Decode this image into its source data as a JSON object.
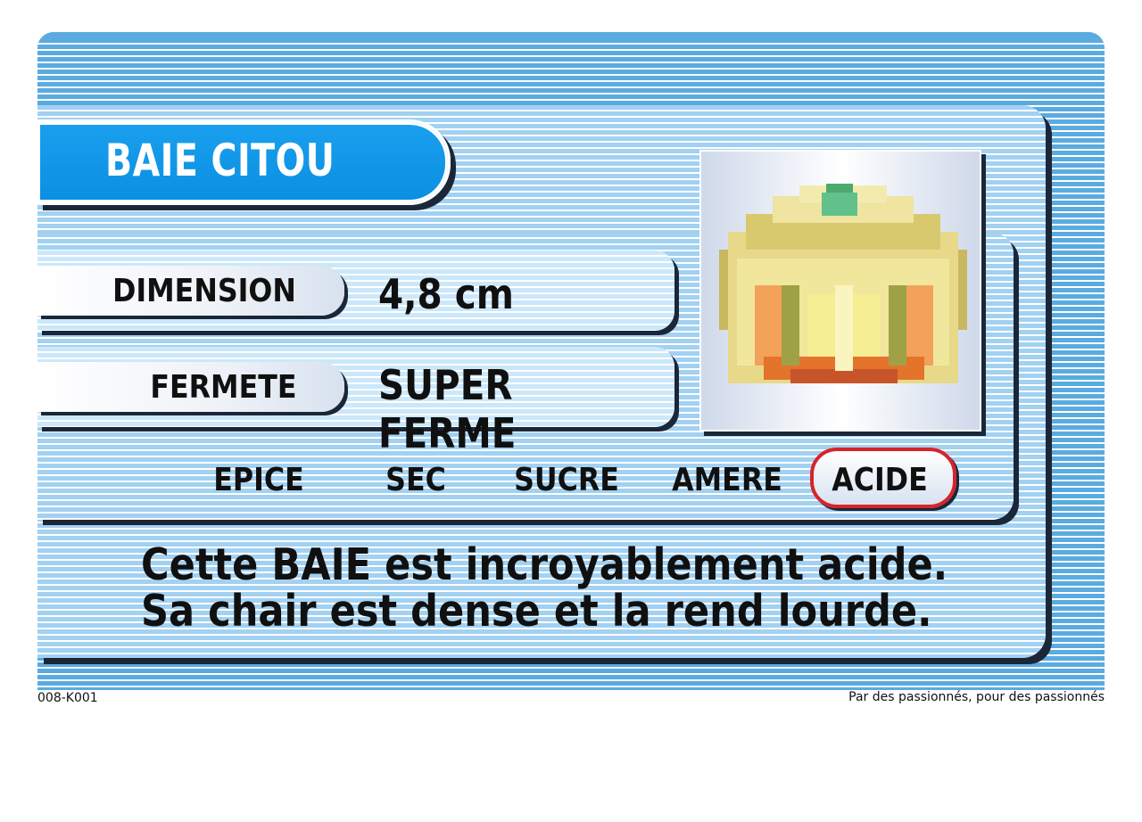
{
  "card": {
    "name": "BAIE CITOU",
    "rows": [
      {
        "label": "DIMENSION",
        "value": "4,8 cm"
      },
      {
        "label": "FERMETE",
        "value": "SUPER FERME"
      }
    ],
    "flavors": [
      "EPICE",
      "SEC",
      "SUCRE",
      "AMERE",
      "ACIDE"
    ],
    "active_flavor": "ACIDE",
    "description_line1": "Cette BAIE est incroyablement acide.",
    "description_line2": "Sa chair est dense et la rend lourde.",
    "berry_icon": "pixel-berry-icon"
  },
  "footer": {
    "code": "008-K001",
    "tagline": "Par des passionnés, pour des passionnés"
  },
  "colors": {
    "stripe_blue": "#5aabe0",
    "banner_blue": "#0a8fe2",
    "highlight_red": "#d8232a"
  }
}
